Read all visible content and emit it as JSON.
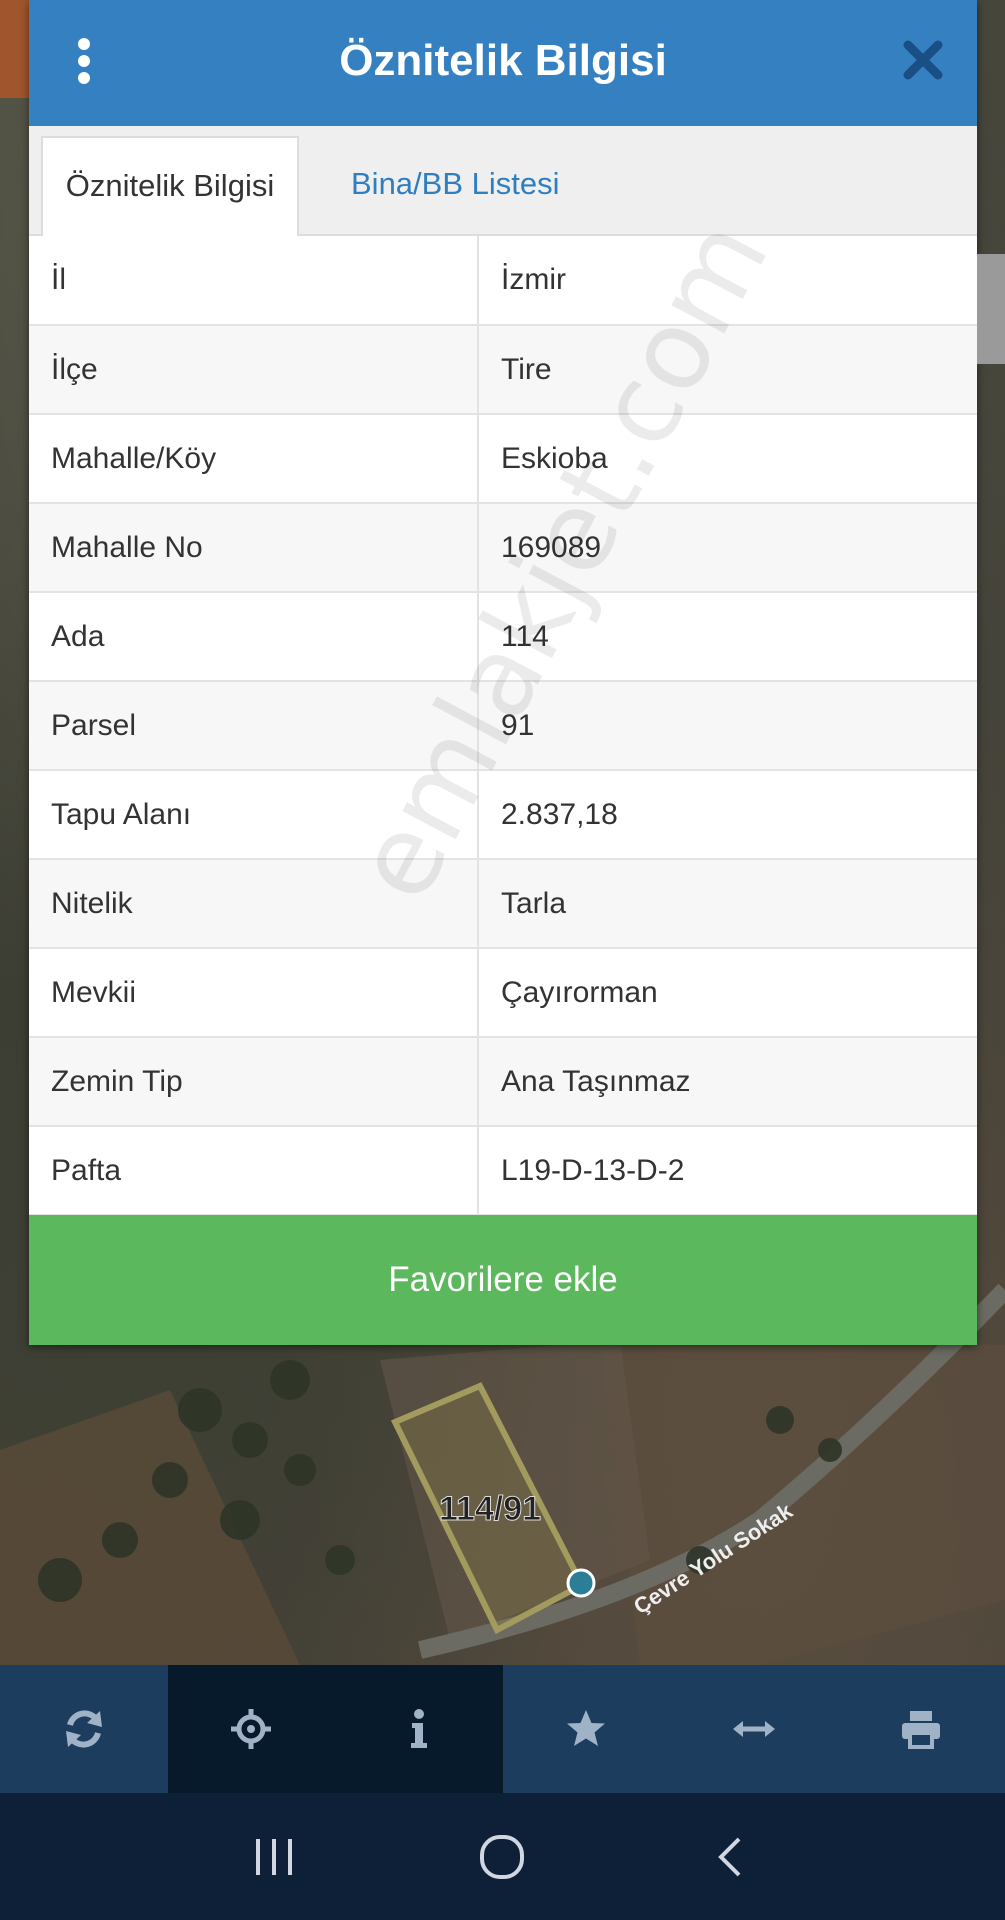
{
  "dialog": {
    "title": "Öznitelik Bilgisi",
    "tabs": [
      {
        "label": "Öznitelik Bilgisi",
        "active": true
      },
      {
        "label": "Bina/BB Listesi",
        "active": false
      }
    ],
    "rows": [
      {
        "key": "İl",
        "value": "İzmir"
      },
      {
        "key": "İlçe",
        "value": "Tire"
      },
      {
        "key": "Mahalle/Köy",
        "value": "Eskioba"
      },
      {
        "key": "Mahalle No",
        "value": "169089"
      },
      {
        "key": "Ada",
        "value": "114"
      },
      {
        "key": "Parsel",
        "value": "91"
      },
      {
        "key": "Tapu Alanı",
        "value": "2.837,18"
      },
      {
        "key": "Nitelik",
        "value": "Tarla"
      },
      {
        "key": "Mevkii",
        "value": "Çayırorman"
      },
      {
        "key": "Zemin Tip",
        "value": "Ana Taşınmaz"
      },
      {
        "key": "Pafta",
        "value": "L19-D-13-D-2"
      }
    ],
    "favorite_button": "Favorilere ekle",
    "watermark": "emlakjet.com"
  },
  "map": {
    "parcel_label": "114/91",
    "street_label": "Çevre Yolu Sokak"
  },
  "toolbar": {
    "icons": [
      "refresh-icon",
      "crosshair-icon",
      "info-icon",
      "star-icon",
      "horizontal-arrows-icon",
      "printer-icon"
    ],
    "active": [
      "crosshair-icon",
      "info-icon"
    ]
  },
  "navbar": {
    "icons": [
      "recent-apps-icon",
      "home-icon",
      "back-icon"
    ]
  },
  "colors": {
    "header": "#3580c1",
    "tab_link": "#2f7fc0",
    "favorite_button": "#5cb85c",
    "toolbar": "#1d3d5e",
    "toolbar_active": "#071a2c",
    "navbar": "#0e2038"
  }
}
